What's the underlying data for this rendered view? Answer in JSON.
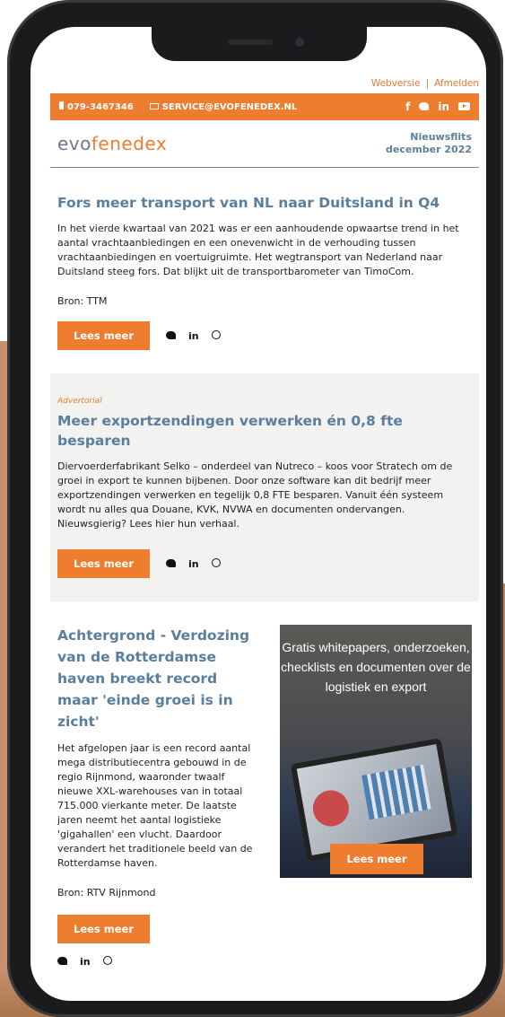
{
  "top_links": {
    "webversie": "Webversie",
    "separator": "|",
    "afmelden": "Afmelden"
  },
  "contact_bar": {
    "phone": "079-3467346",
    "email": "SERVICE@EVOFENEDEX.NL",
    "social": {
      "facebook": "f",
      "linkedin": "in"
    }
  },
  "header": {
    "logo_part1": "evo",
    "logo_part2": "fenedex",
    "newsletter_title": "Nieuwsflits",
    "newsletter_date": "december 2022"
  },
  "articles": [
    {
      "title": "Fors meer transport van NL naar Duitsland in Q4",
      "body": "In het vierde kwartaal van 2021 was er een aanhoudende opwaartse trend in het aantal vrachtaanbiedingen en een onevenwicht in de verhouding tussen vrachtaanbiedingen en voertuigruimte. Het wegtransport van Nederland naar Duitsland steeg fors. Dat blijkt uit de transportbarometer van TimoCom.",
      "source": "Bron: TTM",
      "button": "Lees meer",
      "share_linkedin": "in"
    },
    {
      "label": "Advertorial",
      "title": "Meer exportzendingen verwerken én 0,8 fte besparen",
      "body": "Diervoerderfabrikant Selko – onderdeel van Nutreco – koos voor Stratech om de groei in export te kunnen bijbenen. Door onze software kan dit bedrijf meer exportzendingen verwerken en tegelijk 0,8 FTE besparen. Vanuit één systeem wordt nu alles qua Douane, KVK, NVWA en documenten ondervangen. Nieuwsgierig? Lees hier hun verhaal.",
      "button": "Lees meer",
      "share_linkedin": "in"
    },
    {
      "title": "Achtergrond - Verdozing van de Rotterdamse haven breekt record maar 'einde groei is in zicht'",
      "body": "Het afgelopen jaar is een record aantal mega distributiecentra gebouwd in de regio Rijnmond, waaronder twaalf nieuwe XXL-warehouses van in totaal 715.000 vierkante meter. De laatste jaren neemt het aantal logistieke 'gigahallen' een vlucht. Daardoor verandert het traditionele beeld van de Rotterdamse haven.",
      "source": "Bron: RTV Rijnmond",
      "button": "Lees meer",
      "share_linkedin": "in"
    }
  ],
  "promo": {
    "text": "Gratis whitepapers, onderzoeken, checklists en documenten over de logistiek en export",
    "button": "Lees meer"
  },
  "colors": {
    "accent": "#ef7d2f",
    "title_blue": "#5a7e9e",
    "grey_bg": "#f2f2f0"
  }
}
